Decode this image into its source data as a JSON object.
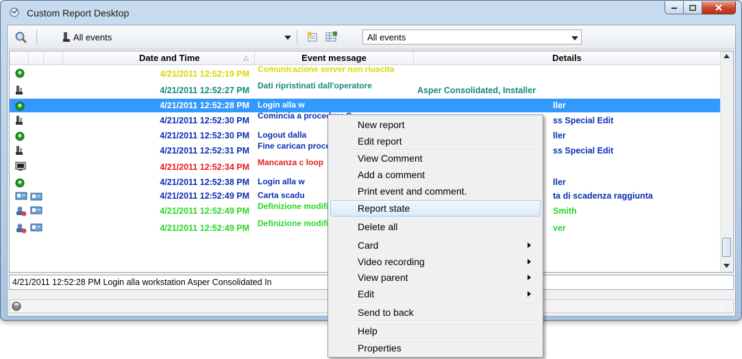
{
  "window": {
    "title": "Custom Report Desktop"
  },
  "toolbar": {
    "filter_label": "All events",
    "combo_value": "All events"
  },
  "columns": {
    "date": "Date and Time",
    "message": "Event message",
    "details": "Details"
  },
  "colors": {
    "yellow": "#d8d800",
    "teal": "#118a7e",
    "blue": "#0a2fb5",
    "red": "#e81c1c",
    "green": "#27d627",
    "selection": "#3399ff"
  },
  "rows": [
    {
      "icon": "green-ok-icon",
      "date": "4/21/2011 12:52:19 PM",
      "msg": "Comunicazione server non riuscita",
      "details": "",
      "color": "yellow"
    },
    {
      "icon": "operator-icon",
      "date": "4/21/2011 12:52:27 PM",
      "msg": "Dati ripristinati dall'operatore",
      "details": "Asper Consolidated, Installer",
      "color": "teal"
    },
    {
      "icon": "green-ok-icon",
      "date": "4/21/2011 12:52:28 PM",
      "msg": "Login alla w",
      "details": "",
      "detail_tail": "ller",
      "color": "white",
      "selected": true
    },
    {
      "icon": "operator-icon",
      "date": "4/21/2011 12:52:30 PM",
      "msg": "Comincia a procedura S",
      "details": "",
      "detail_tail": "ss Special Edit",
      "color": "blue"
    },
    {
      "icon": "green-ok-icon",
      "date": "4/21/2011 12:52:30 PM",
      "msg": "Logout dalla",
      "details": "",
      "detail_tail": "ller",
      "color": "blue"
    },
    {
      "icon": "operator-icon",
      "date": "4/21/2011 12:52:31 PM",
      "msg": "Fine carican procedura s",
      "details": "",
      "detail_tail": "ss Special Edit",
      "color": "blue"
    },
    {
      "icon": "monitor-icon",
      "date": "4/21/2011 12:52:34 PM",
      "msg": "Mancanza c loop",
      "details": "",
      "detail_tail": "",
      "color": "red"
    },
    {
      "icon": "green-ok-icon",
      "date": "4/21/2011 12:52:38 PM",
      "msg": "Login alla w",
      "details": "",
      "detail_tail": "ller",
      "color": "blue"
    },
    {
      "icon": "card-icon",
      "date": "4/21/2011 12:52:49 PM",
      "msg": "Carta scadu",
      "details": "",
      "detail_tail": "ta di scadenza raggiunta",
      "color": "blue"
    },
    {
      "icon": "user-card-icon",
      "date": "4/21/2011 12:52:49 PM",
      "msg": "Definizione modificata",
      "details": "",
      "detail_tail": "Smith",
      "color": "green"
    },
    {
      "icon": "user-card-icon",
      "date": "4/21/2011 12:52:49 PM",
      "msg": "Definizione modificata",
      "details": "",
      "detail_tail": "ver",
      "color": "green"
    }
  ],
  "status": {
    "line": "4/21/2011 12:52:28 PM  Login alla workstation  Asper Consolidated  In"
  },
  "menu": {
    "new_report": "New report",
    "edit_report": "Edit report",
    "view_comment": "View Comment",
    "add_comment": "Add a comment",
    "print": "Print event and comment.",
    "report_state": "Report state",
    "delete_all": "Delete all",
    "card": "Card",
    "video": "Video recording",
    "view_parent": "View parent",
    "edit": "Edit",
    "send_back": "Send to back",
    "help": "Help",
    "properties": "Properties"
  }
}
